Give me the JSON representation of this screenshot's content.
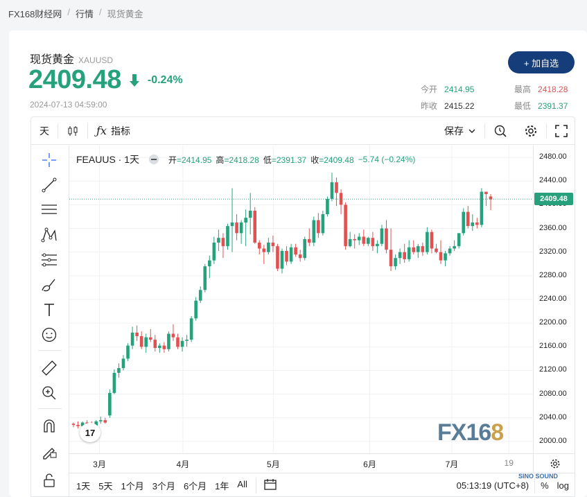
{
  "breadcrumb": [
    "FX168财经网",
    "行情",
    "现货黄金"
  ],
  "header": {
    "title": "现货黄金",
    "symbol": "XAUUSD",
    "price": "2409.48",
    "change": "-0.24%",
    "timestamp": "2024-07-13 04:59:00",
    "add_button": "+ 加自选"
  },
  "stats": {
    "open_label": "今开",
    "open": "2414.95",
    "high_label": "最高",
    "high": "2418.28",
    "prev_close_label": "昨收",
    "prev_close": "2415.22",
    "low_label": "最低",
    "low": "2391.37"
  },
  "toolbar": {
    "interval": "天",
    "indicators_label": "指标",
    "save_label": "保存"
  },
  "legend": {
    "symbol": "FEAUUS · 1天",
    "open_label": "开",
    "open": "=2414.95",
    "high_label": "高",
    "high": "=2418.28",
    "low_label": "低",
    "low": "=2391.37",
    "close_label": "收",
    "close": "=2409.48",
    "change": "−5.74 (−0.24%)"
  },
  "bottom": {
    "ranges": [
      "1天",
      "5天",
      "1个月",
      "3个月",
      "6个月",
      "1年",
      "All"
    ],
    "clock": "05:13:19 (UTC+8)",
    "percent": "%",
    "log": "log"
  },
  "watermark": {
    "fx": "FX16",
    "eight": "8"
  },
  "corner_watermark": "SINO SOUND",
  "tv_logo": "17",
  "colors": {
    "up": "#e05252",
    "down": "#26a17b",
    "accent": "#143d7a"
  },
  "chart_data": {
    "type": "candlestick",
    "yticks": [
      "2480.00",
      "2440.00",
      "2400.00",
      "2360.00",
      "2320.00",
      "2280.00",
      "2240.00",
      "2200.00",
      "2160.00",
      "2120.00",
      "2080.00",
      "2040.00",
      "2000.00"
    ],
    "ylim": [
      1980,
      2500
    ],
    "xticks": [
      "3月",
      "4月",
      "5月",
      "6月",
      "7月",
      "19"
    ],
    "last_price": "2409.48",
    "candles": [
      [
        2030,
        2032,
        2024,
        2028
      ],
      [
        2028,
        2034,
        2022,
        2026
      ],
      [
        2026,
        2034,
        2024,
        2032
      ],
      [
        2032,
        2036,
        2028,
        2030
      ],
      [
        2030,
        2034,
        2024,
        2026
      ],
      [
        2026,
        2036,
        2024,
        2034
      ],
      [
        2034,
        2042,
        2030,
        2036
      ],
      [
        2036,
        2040,
        2030,
        2032
      ],
      [
        2044,
        2088,
        2040,
        2082
      ],
      [
        2082,
        2122,
        2080,
        2116
      ],
      [
        2116,
        2132,
        2108,
        2124
      ],
      [
        2124,
        2146,
        2120,
        2140
      ],
      [
        2140,
        2166,
        2136,
        2162
      ],
      [
        2162,
        2194,
        2156,
        2184
      ],
      [
        2184,
        2196,
        2170,
        2178
      ],
      [
        2178,
        2186,
        2156,
        2160
      ],
      [
        2160,
        2182,
        2150,
        2176
      ],
      [
        2176,
        2190,
        2168,
        2172
      ],
      [
        2172,
        2180,
        2152,
        2158
      ],
      [
        2158,
        2166,
        2150,
        2162
      ],
      [
        2162,
        2168,
        2150,
        2156
      ],
      [
        2156,
        2186,
        2152,
        2182
      ],
      [
        2182,
        2198,
        2170,
        2176
      ],
      [
        2176,
        2182,
        2156,
        2160
      ],
      [
        2160,
        2176,
        2152,
        2170
      ],
      [
        2170,
        2180,
        2160,
        2172
      ],
      [
        2172,
        2212,
        2168,
        2208
      ],
      [
        2208,
        2244,
        2204,
        2238
      ],
      [
        2238,
        2262,
        2234,
        2256
      ],
      [
        2256,
        2300,
        2252,
        2296
      ],
      [
        2296,
        2314,
        2276,
        2306
      ],
      [
        2306,
        2346,
        2300,
        2336
      ],
      [
        2336,
        2358,
        2322,
        2344
      ],
      [
        2344,
        2352,
        2310,
        2330
      ],
      [
        2330,
        2368,
        2324,
        2364
      ],
      [
        2364,
        2428,
        2320,
        2370
      ],
      [
        2370,
        2384,
        2340,
        2352
      ],
      [
        2352,
        2374,
        2334,
        2370
      ],
      [
        2370,
        2392,
        2330,
        2378
      ],
      [
        2378,
        2420,
        2350,
        2390
      ],
      [
        2390,
        2396,
        2334,
        2336
      ],
      [
        2336,
        2340,
        2316,
        2326
      ],
      [
        2326,
        2332,
        2300,
        2320
      ],
      [
        2320,
        2344,
        2316,
        2336
      ],
      [
        2336,
        2348,
        2320,
        2330
      ],
      [
        2330,
        2334,
        2288,
        2292
      ],
      [
        2292,
        2326,
        2284,
        2322
      ],
      [
        2322,
        2330,
        2298,
        2304
      ],
      [
        2304,
        2334,
        2300,
        2328
      ],
      [
        2328,
        2334,
        2312,
        2316
      ],
      [
        2316,
        2324,
        2304,
        2310
      ],
      [
        2310,
        2346,
        2306,
        2342
      ],
      [
        2342,
        2360,
        2330,
        2336
      ],
      [
        2336,
        2380,
        2330,
        2374
      ],
      [
        2374,
        2386,
        2344,
        2352
      ],
      [
        2352,
        2390,
        2348,
        2384
      ],
      [
        2384,
        2414,
        2380,
        2410
      ],
      [
        2410,
        2454,
        2406,
        2438
      ],
      [
        2438,
        2446,
        2398,
        2420
      ],
      [
        2420,
        2426,
        2384,
        2400
      ],
      [
        2400,
        2404,
        2324,
        2330
      ],
      [
        2330,
        2354,
        2328,
        2342
      ],
      [
        2342,
        2350,
        2326,
        2340
      ],
      [
        2340,
        2352,
        2332,
        2346
      ],
      [
        2346,
        2358,
        2330,
        2334
      ],
      [
        2334,
        2346,
        2330,
        2344
      ],
      [
        2344,
        2354,
        2322,
        2330
      ],
      [
        2330,
        2340,
        2318,
        2334
      ],
      [
        2334,
        2366,
        2330,
        2360
      ],
      [
        2360,
        2374,
        2318,
        2324
      ],
      [
        2324,
        2360,
        2288,
        2296
      ],
      [
        2296,
        2316,
        2290,
        2310
      ],
      [
        2310,
        2326,
        2300,
        2320
      ],
      [
        2320,
        2334,
        2302,
        2308
      ],
      [
        2308,
        2340,
        2304,
        2328
      ],
      [
        2328,
        2340,
        2316,
        2320
      ],
      [
        2320,
        2334,
        2310,
        2330
      ],
      [
        2330,
        2336,
        2314,
        2320
      ],
      [
        2320,
        2362,
        2316,
        2354
      ],
      [
        2354,
        2358,
        2318,
        2326
      ],
      [
        2326,
        2334,
        2318,
        2320
      ],
      [
        2320,
        2340,
        2300,
        2306
      ],
      [
        2306,
        2322,
        2296,
        2318
      ],
      [
        2318,
        2330,
        2314,
        2326
      ],
      [
        2326,
        2340,
        2322,
        2330
      ],
      [
        2330,
        2352,
        2326,
        2352
      ],
      [
        2352,
        2394,
        2348,
        2388
      ],
      [
        2388,
        2398,
        2360,
        2364
      ],
      [
        2364,
        2384,
        2356,
        2370
      ],
      [
        2370,
        2378,
        2360,
        2366
      ],
      [
        2366,
        2428,
        2362,
        2422
      ],
      [
        2422,
        2420,
        2398,
        2418
      ],
      [
        2414,
        2418,
        2391,
        2409
      ]
    ]
  }
}
